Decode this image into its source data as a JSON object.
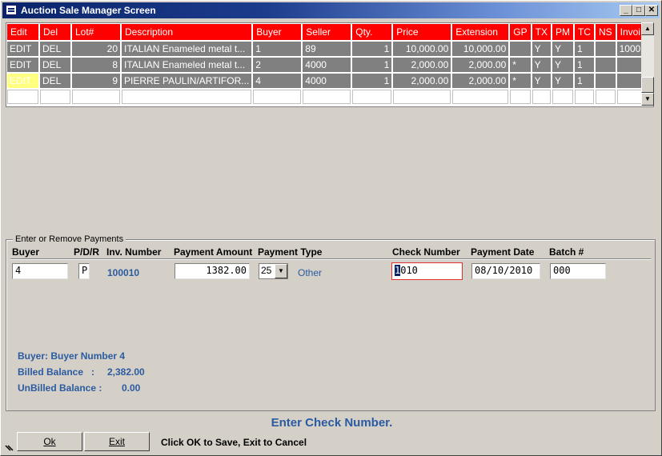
{
  "window": {
    "title": "Auction Sale Manager Screen",
    "minimize": "_",
    "maximize": "□",
    "close": "✕"
  },
  "grid": {
    "columns": [
      "Edit",
      "Del",
      "Lot#",
      "Description",
      "Buyer",
      "Seller",
      "Qty.",
      "Price",
      "Extension",
      "GP",
      "TX",
      "PM",
      "TC",
      "NS",
      "Invoi"
    ],
    "rows": [
      {
        "edit": "EDIT",
        "del": "DEL",
        "lot": "20",
        "desc": "ITALIAN Enameled metal t...",
        "buyer": "1",
        "seller": "89",
        "qty": "1",
        "price": "10,000.00",
        "ext": "10,000.00",
        "gp": "",
        "tx": "Y",
        "pm": "Y",
        "tc": "1",
        "ns": "",
        "inv": "1000"
      },
      {
        "edit": "EDIT",
        "del": "DEL",
        "lot": "8",
        "desc": "ITALIAN Enameled metal t...",
        "buyer": "2",
        "seller": "4000",
        "qty": "1",
        "price": "2,000.00",
        "ext": "2,000.00",
        "gp": "*",
        "tx": "Y",
        "pm": "Y",
        "tc": "1",
        "ns": "",
        "inv": ""
      },
      {
        "edit": "EDIT",
        "del": "DEL",
        "lot": "9",
        "desc": "PIERRE PAULIN/ARTIFOR...",
        "buyer": "4",
        "seller": "4000",
        "qty": "1",
        "price": "2,000.00",
        "ext": "2,000.00",
        "gp": "*",
        "tx": "Y",
        "pm": "Y",
        "tc": "1",
        "ns": "",
        "inv": ""
      }
    ]
  },
  "payments": {
    "legend": "Enter or Remove Payments",
    "headers": {
      "buyer": "Buyer",
      "pdr": "P/D/R",
      "inv": "Inv. Number",
      "amount": "Payment Amount",
      "type": "Payment Type",
      "check": "Check Number",
      "date": "Payment Date",
      "batch": "Batch #"
    },
    "values": {
      "buyer": "4",
      "pdr": "P",
      "inv": "100010",
      "amount": "1382.00",
      "type_code": "25",
      "type_name": "Other",
      "check_caret": "1",
      "check_rest": "010",
      "date": "08/10/2010",
      "batch": "000"
    },
    "summary": {
      "buyer_line": "Buyer: Buyer Number 4",
      "billed_label": "Billed Balance   :",
      "billed_value": "2,382.00",
      "unbilled_label": "UnBilled Balance :",
      "unbilled_value": "0.00"
    }
  },
  "status": {
    "message": "Enter Check Number.",
    "hint": "Click OK to Save, Exit to Cancel"
  },
  "buttons": {
    "ok": "Ok",
    "exit": "Exit"
  }
}
